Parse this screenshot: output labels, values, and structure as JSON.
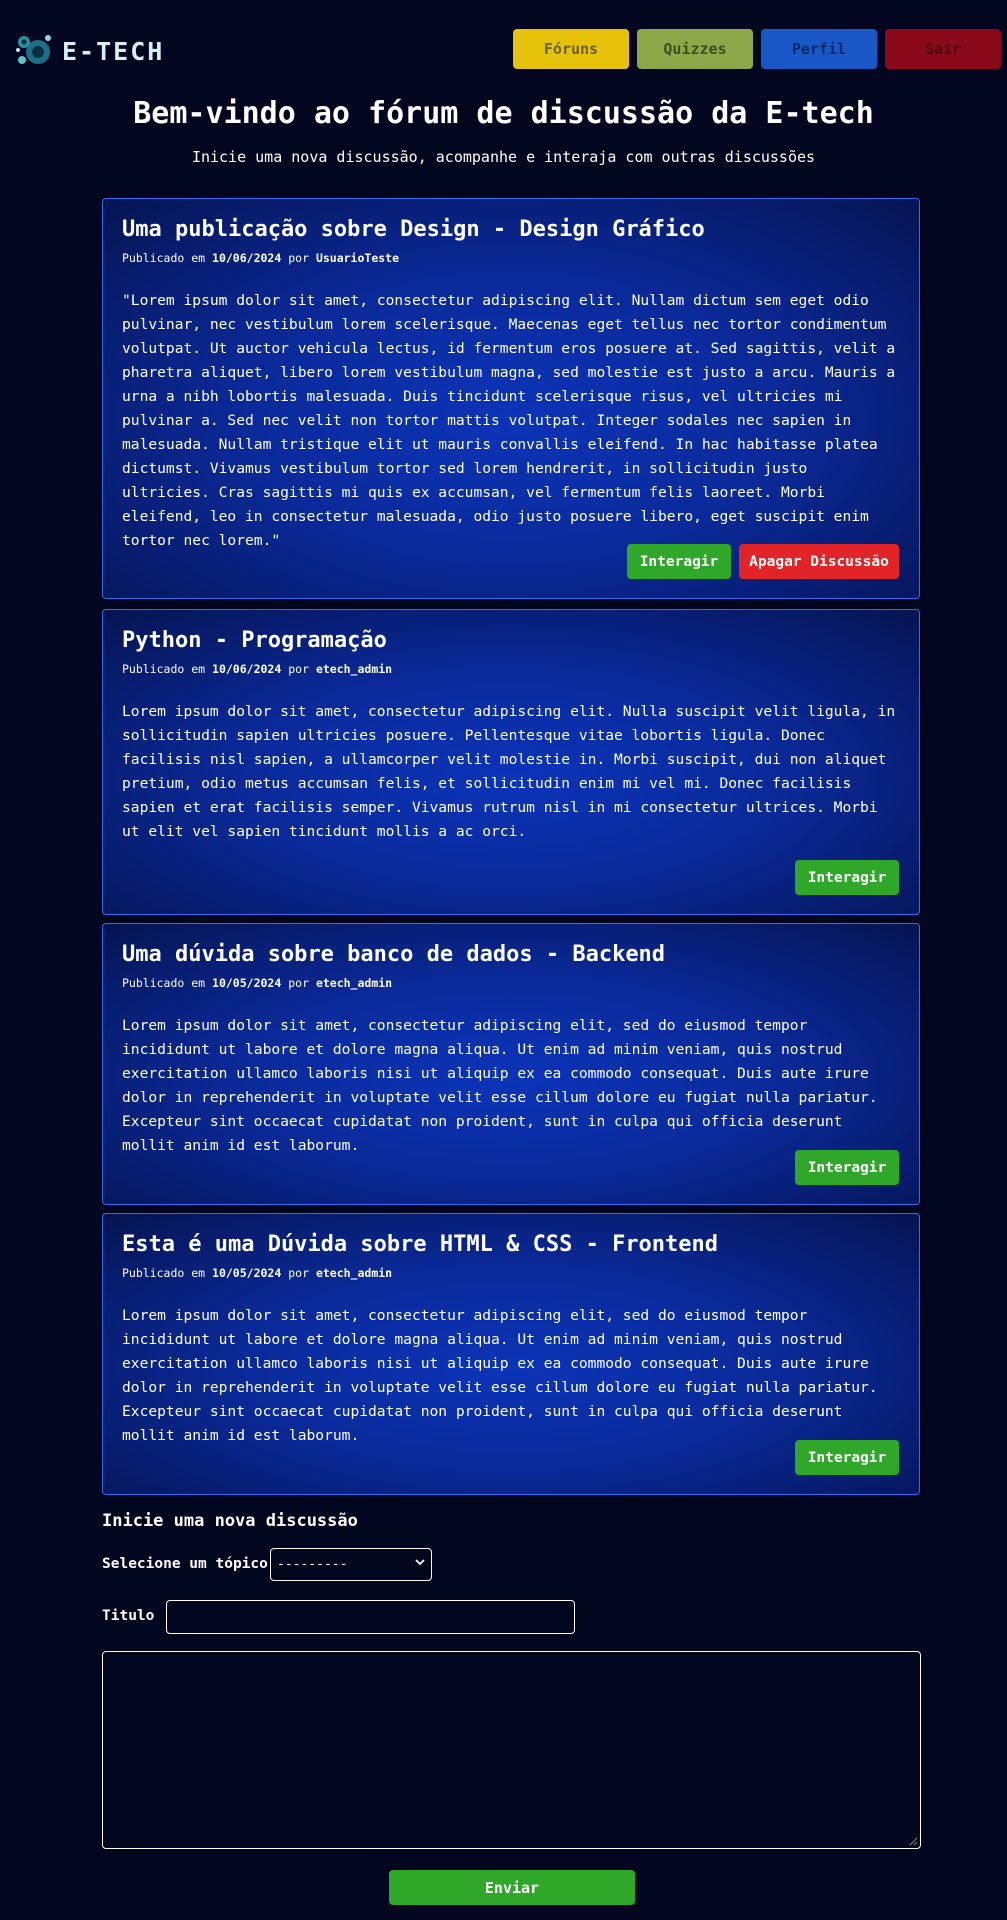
{
  "header": {
    "logo_text": "E-TECH",
    "nav": [
      {
        "label": "Fóruns"
      },
      {
        "label": "Quizzes"
      },
      {
        "label": "Perfil"
      },
      {
        "label": "Sair"
      }
    ]
  },
  "hero": {
    "title": "Bem-vindo ao fórum de discussão da E-tech",
    "subtitle": "Inicie uma nova discussão, acompanhe e interaja com outras discussões"
  },
  "posts": [
    {
      "title": "Uma publicação sobre Design - Design Gráfico",
      "meta_prefix": "Publicado em",
      "date": "10/06/2024",
      "meta_by": "por",
      "author": "UsuarioTeste",
      "body": "\"Lorem ipsum dolor sit amet, consectetur adipiscing elit. Nullam dictum sem eget odio pulvinar, nec vestibulum lorem scelerisque. Maecenas eget tellus nec tortor condimentum volutpat. Ut auctor vehicula lectus, id fermentum eros posuere at. Sed sagittis, velit a pharetra aliquet, libero lorem vestibulum magna, sed molestie est justo a arcu. Mauris a urna a nibh lobortis malesuada. Duis tincidunt scelerisque risus, vel ultricies mi pulvinar a. Sed nec velit non tortor mattis volutpat. Integer sodales nec sapien in malesuada. Nullam tristique elit ut mauris convallis eleifend. In hac habitasse platea dictumst. Vivamus vestibulum tortor sed lorem hendrerit, in sollicitudin justo ultricies. Cras sagittis mi quis ex accumsan, vel fermentum felis laoreet. Morbi eleifend, leo in consectetur malesuada, odio justo posuere libero, eget suscipit enim tortor nec lorem.\"",
      "interact_label": "Interagir",
      "delete_label": "Apagar Discussão"
    },
    {
      "title": "Python - Programação",
      "meta_prefix": "Publicado em",
      "date": "10/06/2024",
      "meta_by": "por",
      "author": "etech_admin",
      "body": "Lorem ipsum dolor sit amet, consectetur adipiscing elit. Nulla suscipit velit ligula, in sollicitudin sapien ultricies posuere. Pellentesque vitae lobortis ligula. Donec facilisis nisl sapien, a ullamcorper velit molestie in. Morbi suscipit, dui non aliquet pretium, odio metus accumsan felis, et sollicitudin enim mi vel mi. Donec facilisis sapien et erat facilisis semper. Vivamus rutrum nisl in mi consectetur ultrices. Morbi ut elit vel sapien tincidunt mollis a ac orci.",
      "interact_label": "Interagir"
    },
    {
      "title": "Uma dúvida sobre banco de dados - Backend",
      "meta_prefix": "Publicado em",
      "date": "10/05/2024",
      "meta_by": "por",
      "author": "etech_admin",
      "body": "Lorem ipsum dolor sit amet, consectetur adipiscing elit, sed do eiusmod tempor incididunt ut labore et dolore magna aliqua. Ut enim ad minim veniam, quis nostrud exercitation ullamco laboris nisi ut aliquip ex ea commodo consequat. Duis aute irure dolor in reprehenderit in voluptate velit esse cillum dolore eu fugiat nulla pariatur. Excepteur sint occaecat cupidatat non proident, sunt in culpa qui officia deserunt mollit anim id est laborum.",
      "interact_label": "Interagir"
    },
    {
      "title": "Esta é uma Dúvida sobre HTML & CSS - Frontend",
      "meta_prefix": "Publicado em",
      "date": "10/05/2024",
      "meta_by": "por",
      "author": "etech_admin",
      "body": "Lorem ipsum dolor sit amet, consectetur adipiscing elit, sed do eiusmod tempor incididunt ut labore et dolore magna aliqua. Ut enim ad minim veniam, quis nostrud exercitation ullamco laboris nisi ut aliquip ex ea commodo consequat. Duis aute irure dolor in reprehenderit in voluptate velit esse cillum dolore eu fugiat nulla pariatur. Excepteur sint occaecat cupidatat non proident, sunt in culpa qui officia deserunt mollit anim id est laborum.",
      "interact_label": "Interagir"
    }
  ],
  "new_discussion": {
    "heading": "Inicie uma nova discussão",
    "topic_label": "Selecione um tópico",
    "topic_selected": "---------",
    "title_label": "Titulo",
    "title_value": "",
    "body_value": "",
    "submit_label": "Enviar"
  }
}
